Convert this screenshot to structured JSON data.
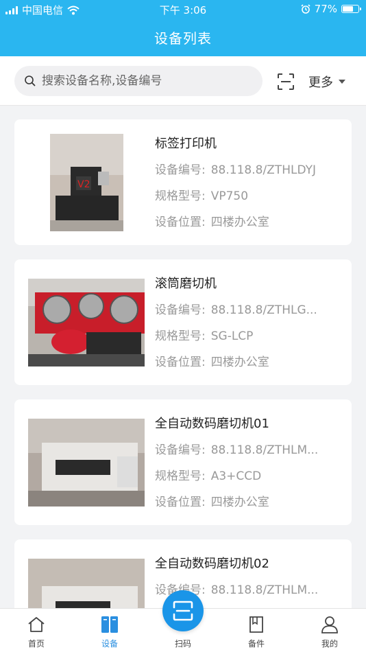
{
  "status": {
    "carrier": "中国电信",
    "time": "下午 3:06",
    "battery": "77%"
  },
  "header": {
    "title": "设备列表"
  },
  "search": {
    "placeholder": "搜索设备名称,设备编号"
  },
  "more_label": "更多",
  "field_labels": {
    "code": "设备编号:",
    "model": "规格型号:",
    "location": "设备位置:"
  },
  "devices": [
    {
      "name": "标签打印机",
      "code": "88.118.8/ZTHLDYJ",
      "model": "VP750",
      "location": "四楼办公室"
    },
    {
      "name": "滚筒磨切机",
      "code": "88.118.8/ZTHLG...",
      "model": "SG-LCP",
      "location": "四楼办公室"
    },
    {
      "name": "全自动数码磨切机01",
      "code": "88.118.8/ZTHLM...",
      "model": "A3+CCD",
      "location": "四楼办公室"
    },
    {
      "name": "全自动数码磨切机02",
      "code": "88.118.8/ZTHLM..."
    }
  ],
  "tabs": [
    {
      "label": "首页",
      "icon": "home-icon"
    },
    {
      "label": "设备",
      "icon": "device-icon"
    },
    {
      "label": "扫码",
      "icon": "scan-icon"
    },
    {
      "label": "备件",
      "icon": "parts-icon"
    },
    {
      "label": "我的",
      "icon": "user-icon"
    }
  ],
  "colors": {
    "accent": "#2ab6f0",
    "tab_active": "#2a8fe0",
    "fab": "#1a95e8"
  }
}
